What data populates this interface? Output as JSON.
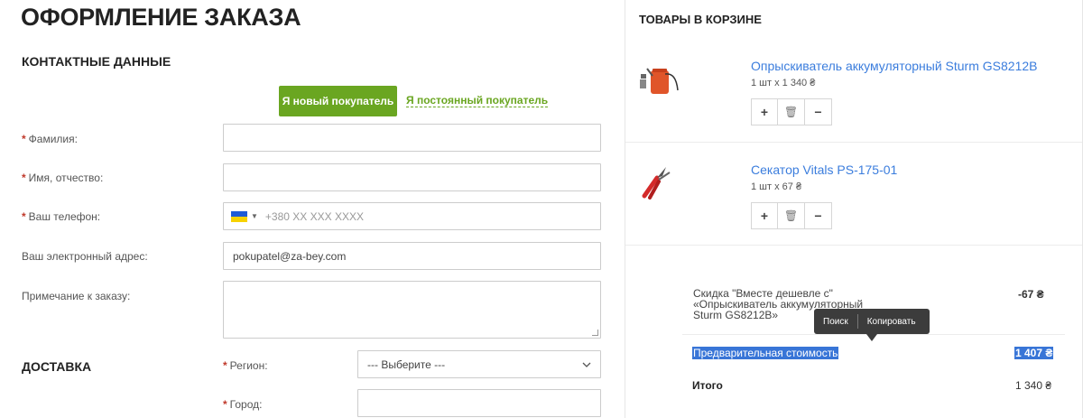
{
  "page": {
    "title": "ОФОРМЛЕНИЕ ЗАКАЗА"
  },
  "contact": {
    "title": "КОНТАКТНЫЕ ДАННЫЕ",
    "new_buyer": "Я новый покупатель",
    "regular_buyer": "Я постоянный покупатель",
    "lastname_label": "Фамилия:",
    "name_label": "Имя, отчество:",
    "phone_label": "Ваш телефон:",
    "phone_placeholder": "+380 XX XXX XXXX",
    "email_label": "Ваш электронный адрес:",
    "email_value": "pokupatel@za-bey.com",
    "note_label": "Примечание к заказу:",
    "required_mark": "*"
  },
  "delivery": {
    "title": "ДОСТАВКА",
    "region_label": "Регион:",
    "region_value": "--- Выберите ---",
    "city_label": "Город:"
  },
  "cart": {
    "title": "ТОВАРЫ В КОРЗИНЕ",
    "items": [
      {
        "name": "Опрыскиватель аккумуляторный Sturm GS8212B",
        "qty": "1 шт x 1 340 ₴"
      },
      {
        "name": "Секатор Vitals PS-175-01",
        "qty": "1 шт x 67 ₴"
      }
    ],
    "plus": "+",
    "minus": "−",
    "trash": "🗑"
  },
  "summary": {
    "discount_label": "Скидка \"Вместе дешевле с\" «Опрыскиватель аккумуляторный Sturm GS8212B»",
    "discount_value": "-67 ₴",
    "preliminary_label": "Предварительная стоимость",
    "preliminary_value": "1 407 ₴",
    "total_label": "Итого",
    "total_value": "1 340 ₴"
  },
  "context_menu": {
    "search": "Поиск",
    "copy": "Копировать"
  },
  "colors": {
    "accent_green": "#6aa621",
    "link_blue": "#3b7ddd",
    "selection": "#3875d7"
  }
}
